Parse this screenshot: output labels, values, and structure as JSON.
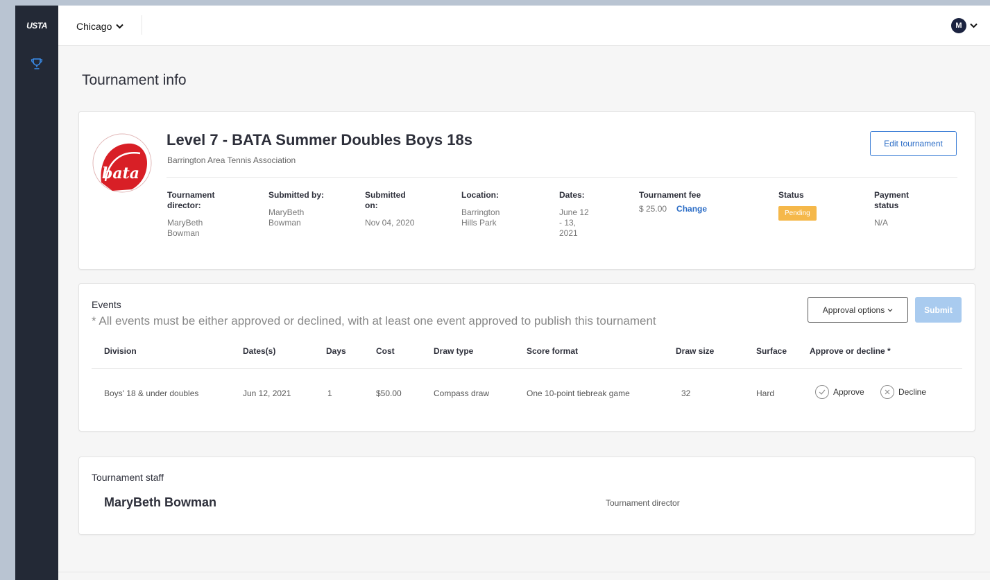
{
  "sidebar": {
    "logo_text": "USTA",
    "nav_icon": "trophy-icon",
    "bg_color": "#232936"
  },
  "topbar": {
    "city": "Chicago",
    "user_initial": "M"
  },
  "page": {
    "title": "Tournament info"
  },
  "tournament": {
    "logo_text": "bata",
    "logo_ring_text": "BARRINGTON AREA TENNIS ASSOCIATION",
    "title": "Level 7 - BATA Summer Doubles Boys 18s",
    "organization": "Barrington Area Tennis Association",
    "edit_label": "Edit tournament",
    "meta": {
      "director_label": "Tournament director:",
      "director_value": "MaryBeth Bowman",
      "submitted_by_label": "Submitted by:",
      "submitted_by_value": "MaryBeth Bowman",
      "submitted_on_label": "Submitted on:",
      "submitted_on_value": "Nov 04, 2020",
      "location_label": "Location:",
      "location_value": "Barrington Hills Park",
      "dates_label": "Dates:",
      "dates_value": "June 12 - 13, 2021",
      "fee_label": "Tournament fee",
      "fee_value": "$ 25.00",
      "fee_change": "Change",
      "status_label": "Status",
      "status_value": "Pending",
      "payment_label": "Payment status",
      "payment_value": "N/A"
    }
  },
  "events": {
    "title": "Events",
    "note": "* All events must be either approved or declined, with at least one event approved to publish this tournament",
    "approval_options": "Approval options",
    "submit": "Submit",
    "columns": [
      "Division",
      "Dates(s)",
      "Days",
      "Cost",
      "Draw type",
      "Score format",
      "Draw size",
      "Surface",
      "Approve or decline *"
    ],
    "rows": [
      {
        "division": "Boys' 18 & under doubles",
        "dates": "Jun 12, 2021",
        "days": "1",
        "cost": "$50.00",
        "draw_type": "Compass draw",
        "score_format": "One 10-point tiebreak game",
        "draw_size": "32",
        "surface": "Hard",
        "approve": "Approve",
        "decline": "Decline"
      }
    ]
  },
  "staff": {
    "title": "Tournament staff",
    "members": [
      {
        "name": "MaryBeth Bowman",
        "role": "Tournament director"
      }
    ]
  },
  "colors": {
    "accent": "#2a6cc6",
    "pending": "#f5b84a",
    "submit_disabled": "#a9cbef",
    "logo_red": "#d81f26"
  }
}
